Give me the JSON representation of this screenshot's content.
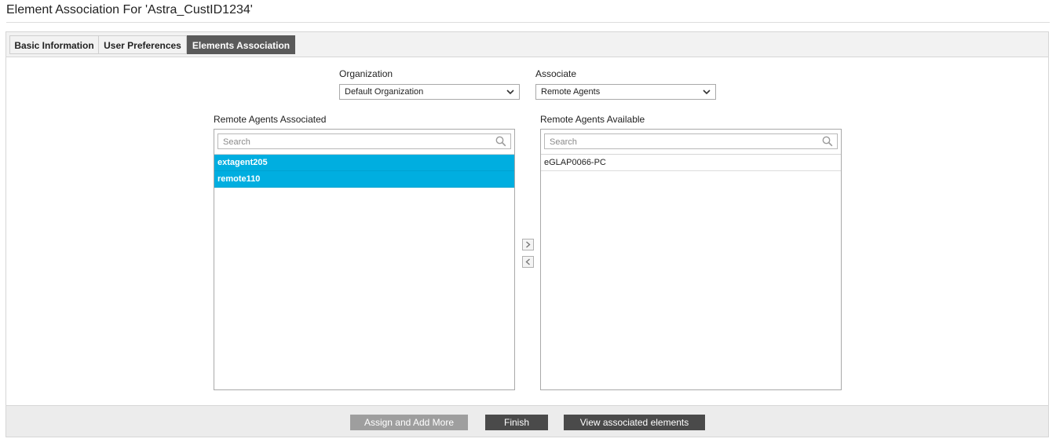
{
  "header": {
    "title": "Element Association For 'Astra_CustID1234'"
  },
  "tabs": [
    {
      "label": "Basic Information",
      "active": false
    },
    {
      "label": "User Preferences",
      "active": false
    },
    {
      "label": "Elements Association",
      "active": true
    }
  ],
  "filters": {
    "organization": {
      "label": "Organization",
      "value": "Default Organization"
    },
    "associate": {
      "label": "Associate",
      "value": "Remote Agents"
    }
  },
  "associated_list": {
    "title": "Remote Agents Associated",
    "search_placeholder": "Search",
    "items": [
      {
        "label": "extagent205",
        "selected": true
      },
      {
        "label": "remote110",
        "selected": true
      }
    ]
  },
  "available_list": {
    "title": "Remote Agents Available",
    "search_placeholder": "Search",
    "items": [
      {
        "label": "eGLAP0066-PC",
        "selected": false
      }
    ]
  },
  "transfer": {
    "move_right_icon": "chevron-right-icon",
    "move_left_icon": "chevron-left-icon"
  },
  "footer": {
    "assign_label": "Assign and Add More",
    "finish_label": "Finish",
    "view_label": "View associated elements"
  },
  "colors": {
    "selected_row": "#00aee0",
    "active_tab": "#5a5a5a",
    "dark_button": "#4a4a4a",
    "disabled_button": "#9e9e9e"
  }
}
